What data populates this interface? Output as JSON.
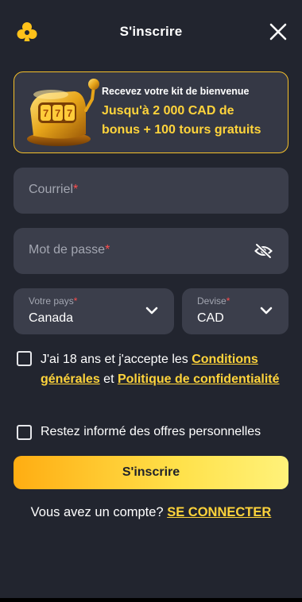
{
  "header": {
    "title": "S'inscrire",
    "logo_icon": "clover-logo-icon",
    "close_icon": "close-icon"
  },
  "promo": {
    "subtitle": "Recevez votre kit de bienvenue",
    "title_line1": "Jusqu'à 2 000 CAD de",
    "title_line2": "bonus + 100 tours gratuits",
    "image": "golden-slot-machine"
  },
  "form": {
    "email": {
      "placeholder": "Courriel",
      "required_mark": "*"
    },
    "password": {
      "placeholder": "Mot de passe",
      "required_mark": "*",
      "toggle_icon": "eye-hidden-icon"
    },
    "country": {
      "label": "Votre pays",
      "required_mark": "*",
      "value": "Canada"
    },
    "currency": {
      "label": "Devise",
      "required_mark": "*",
      "value": "CAD"
    },
    "terms": {
      "prefix": "J'ai 18 ans et j'accepte les ",
      "link1": "Conditions générales",
      "middle": " et ",
      "link2": "Politique de confidentialité",
      "checked": false
    },
    "newsletter": {
      "label": "Restez informé des offres personnelles",
      "checked": false
    },
    "submit_label": "S'inscrire"
  },
  "footer": {
    "question": "Vous avez un compte? ",
    "login_label": "SE CONNECTER"
  },
  "colors": {
    "background": "#22252f",
    "field": "#3b3e4b",
    "accent": "#ffd43b",
    "required": "#ff4d4d"
  }
}
